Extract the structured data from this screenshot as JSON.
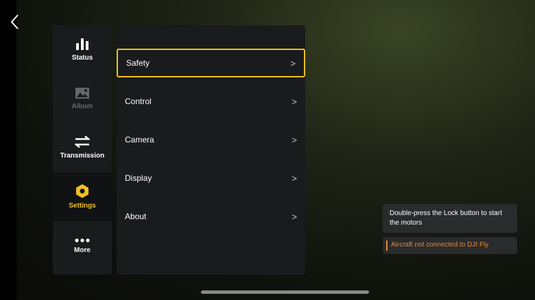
{
  "sidebar": {
    "items": [
      {
        "label": "Status",
        "icon": "bar-chart-icon"
      },
      {
        "label": "Album",
        "icon": "image-icon"
      },
      {
        "label": "Transmission",
        "icon": "swap-arrows-icon"
      },
      {
        "label": "Settings",
        "icon": "hex-nut-icon"
      },
      {
        "label": "More",
        "icon": "more-dots-icon"
      }
    ],
    "active": "Settings"
  },
  "menu": {
    "items": [
      {
        "label": "Safety"
      },
      {
        "label": "Control"
      },
      {
        "label": "Camera"
      },
      {
        "label": "Display"
      },
      {
        "label": "About"
      }
    ],
    "selected": "Safety"
  },
  "notifications": {
    "hint": "Double-press the Lock button to start the motors",
    "warning": "Aircraft not connected to DJI Fly"
  },
  "colors": {
    "accent": "#f0c020",
    "warning": "#e08a3c"
  }
}
